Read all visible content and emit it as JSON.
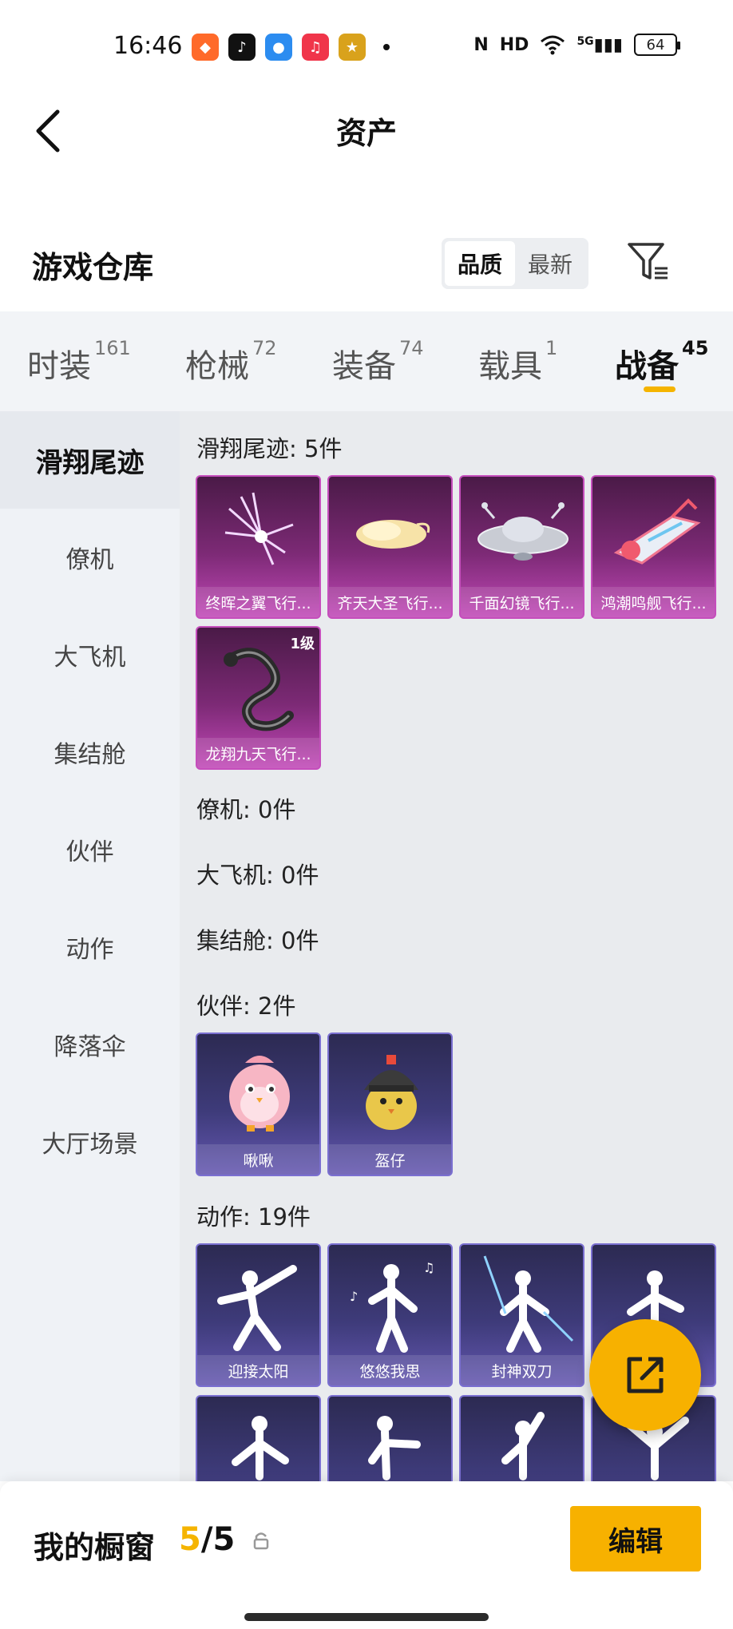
{
  "status_bar": {
    "time": "16:46",
    "battery": "64",
    "network": "5G"
  },
  "header": {
    "title": "资产"
  },
  "warehouse": {
    "title": "游戏仓库",
    "sort_options": [
      "品质",
      "最新"
    ],
    "active_sort": "品质"
  },
  "tabs": [
    {
      "label": "时装",
      "count": "161"
    },
    {
      "label": "枪械",
      "count": "72"
    },
    {
      "label": "装备",
      "count": "74"
    },
    {
      "label": "载具",
      "count": "1"
    },
    {
      "label": "战备",
      "count": "45"
    }
  ],
  "active_tab": "战备",
  "sidebar": {
    "items": [
      "滑翔尾迹",
      "僚机",
      "大飞机",
      "集结舱",
      "伙伴",
      "动作",
      "降落伞",
      "大厅场景"
    ],
    "active": "滑翔尾迹"
  },
  "sections": {
    "glide": {
      "title": "滑翔尾迹: 5件",
      "items": [
        "终晖之翼飞行...",
        "齐天大圣飞行...",
        "千面幻镜飞行...",
        "鸿潮鸣舰飞行...",
        "龙翔九天飞行..."
      ],
      "level_badge": "1级"
    },
    "wingman": {
      "title": "僚机: 0件"
    },
    "big_plane": {
      "title": "大飞机: 0件"
    },
    "assembly": {
      "title": "集结舱: 0件"
    },
    "partner": {
      "title": "伙伴: 2件",
      "items": [
        "啾啾",
        "盔仔"
      ]
    },
    "action": {
      "title": "动作: 19件",
      "items": [
        "迎接太阳",
        "悠悠我思",
        "封神双刀"
      ]
    }
  },
  "bottom_bar": {
    "label": "我的橱窗",
    "current": "5",
    "total": "5",
    "separator": "/",
    "edit_label": "编辑"
  },
  "colors": {
    "accent": "#f7b100",
    "legendary_card": "#c54ebc",
    "epic_card": "#7a6fd0"
  }
}
